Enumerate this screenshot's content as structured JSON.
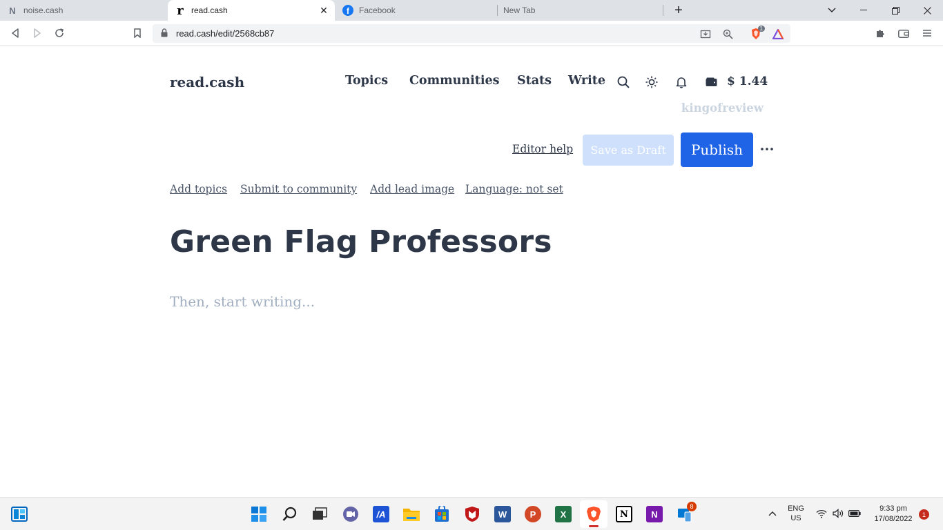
{
  "browser": {
    "tabs": [
      {
        "label": "noise.cash",
        "favicon": "noise-cash-favicon",
        "active": false
      },
      {
        "label": "read.cash",
        "favicon": "read-cash-favicon",
        "active": true
      },
      {
        "label": "Facebook",
        "favicon": "facebook-favicon",
        "active": false
      },
      {
        "label": "New Tab",
        "favicon": "",
        "active": false
      }
    ],
    "new_tab_icon": "plus-icon",
    "url": "read.cash/edit/2568cb87",
    "brave_shield_count": "1"
  },
  "site": {
    "logo": "read.cash",
    "nav": {
      "topics": "Topics",
      "communities": "Communities",
      "stats": "Stats",
      "write": "Write"
    },
    "balance": "$ 1.44",
    "username": "kingofreview"
  },
  "editor": {
    "help_label": "Editor help",
    "draft_label": "Save as Draft",
    "publish_label": "Publish",
    "meta_links": {
      "topics": "Add topics",
      "community": "Submit to community",
      "lead_image": "Add lead image",
      "language": "Language: not set"
    },
    "title": "Green Flag Professors",
    "body_placeholder": "Then, start writing..."
  },
  "colors": {
    "publish": "#1f63e6",
    "draft_disabled": "#cfe0fc",
    "text": "#2d3748",
    "muted": "#a0aec0"
  },
  "taskbar": {
    "apps": [
      "start",
      "search",
      "task-view",
      "teams-chat",
      "app-studio",
      "file-explorer",
      "microsoft-store",
      "mcafee",
      "word",
      "powerpoint",
      "excel",
      "brave",
      "notion",
      "onenote",
      "phone-link"
    ],
    "phone_link_badge": "8",
    "language_line1": "ENG",
    "language_line2": "US",
    "time": "9:33 pm",
    "date": "17/08/2022",
    "notification_count": "1"
  }
}
